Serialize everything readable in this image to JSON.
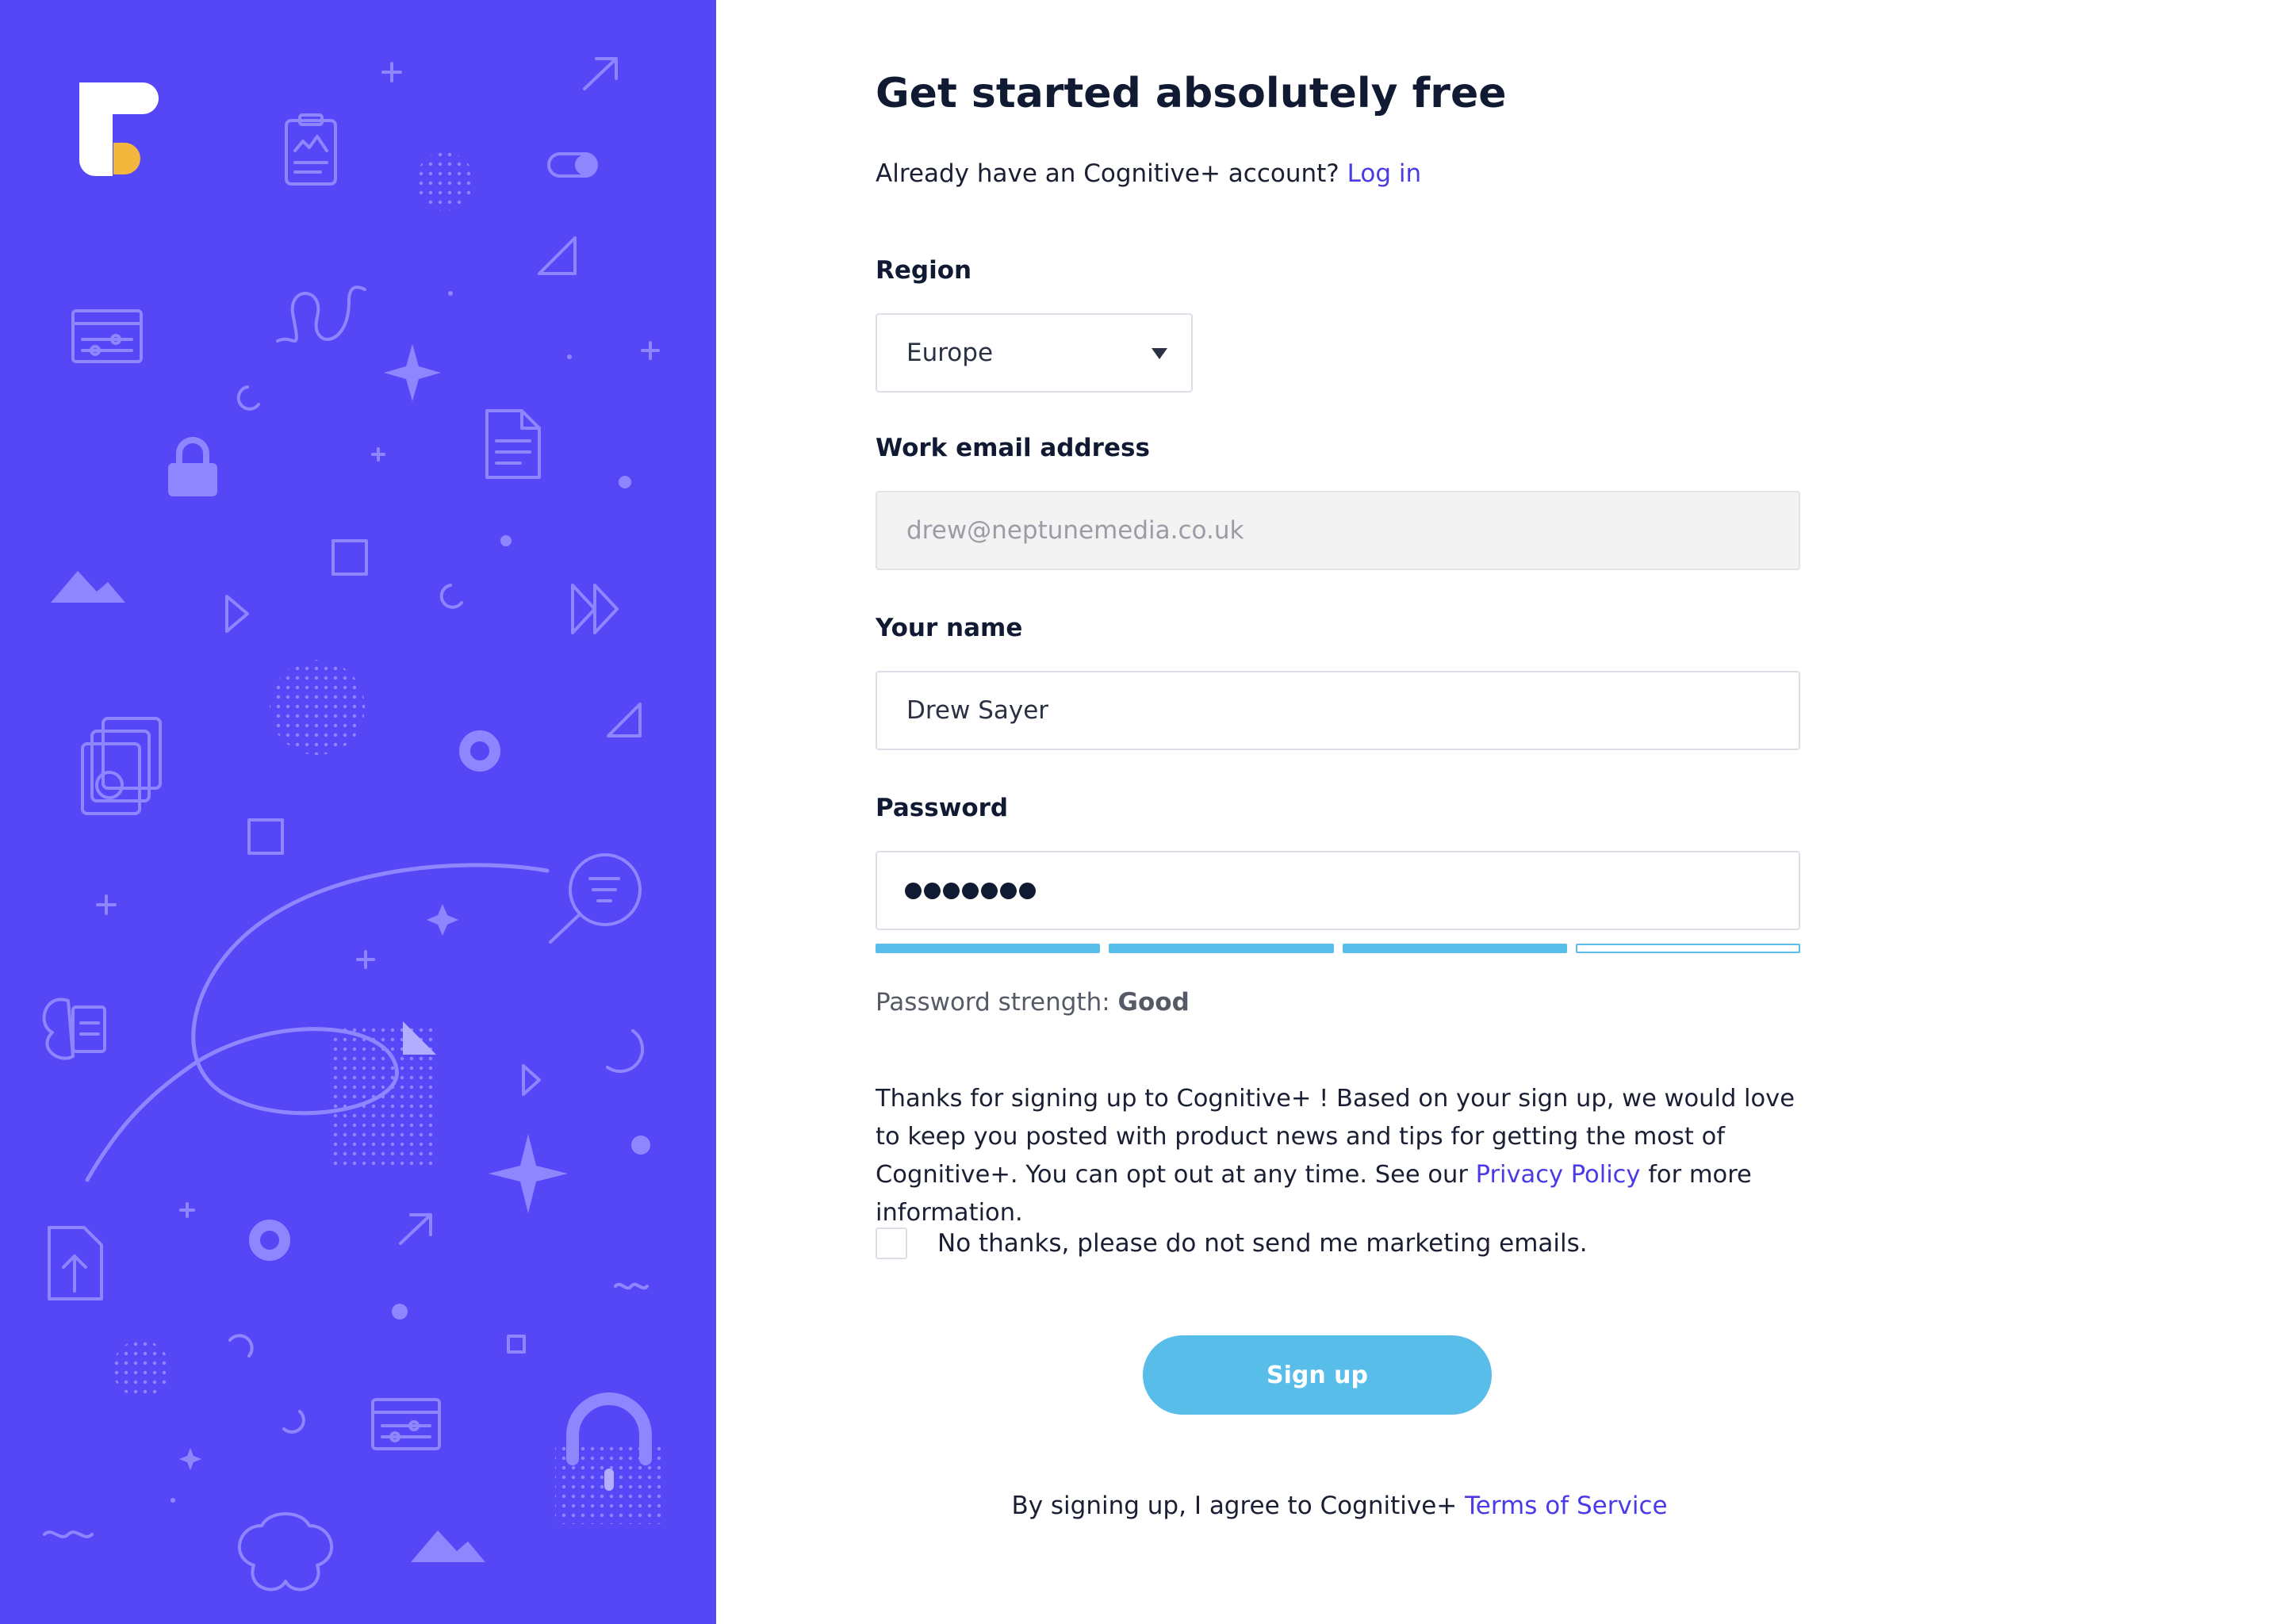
{
  "brand": {
    "logo_icon": "cognitive-plus-logo",
    "accent": "#5546f6",
    "logo_accent": "#f4b73e"
  },
  "page": {
    "title": "Get started absolutely free",
    "login_prompt": "Already have an Cognitive+ account?",
    "login_link": "Log in"
  },
  "form": {
    "region": {
      "label": "Region",
      "value": "Europe"
    },
    "email": {
      "label": "Work email address",
      "value": "drew@neptunemedia.co.uk"
    },
    "name": {
      "label": "Your name",
      "value": "Drew Sayer"
    },
    "password": {
      "label": "Password",
      "masked_length": 7,
      "strength_segments_total": 4,
      "strength_segments_filled": 3,
      "strength_prefix": "Password strength:",
      "strength_value": "Good"
    }
  },
  "notice": {
    "text_before": "Thanks for signing up to Cognitive+ ! Based on your sign up, we would love to keep you posted with product news and tips for getting the most of Cognitive+. You can opt out at any time. See our",
    "privacy_link": "Privacy Policy",
    "text_after": "for more information."
  },
  "optout": {
    "label": "No thanks, please do not send me marketing emails.",
    "checked": false
  },
  "signup_button": "Sign up",
  "terms": {
    "text": "By signing up, I agree to Cognitive+",
    "link": "Terms of Service"
  },
  "colors": {
    "primary_button": "#58bde9",
    "link": "#4a3be6",
    "side_panel": "#5546f6"
  }
}
